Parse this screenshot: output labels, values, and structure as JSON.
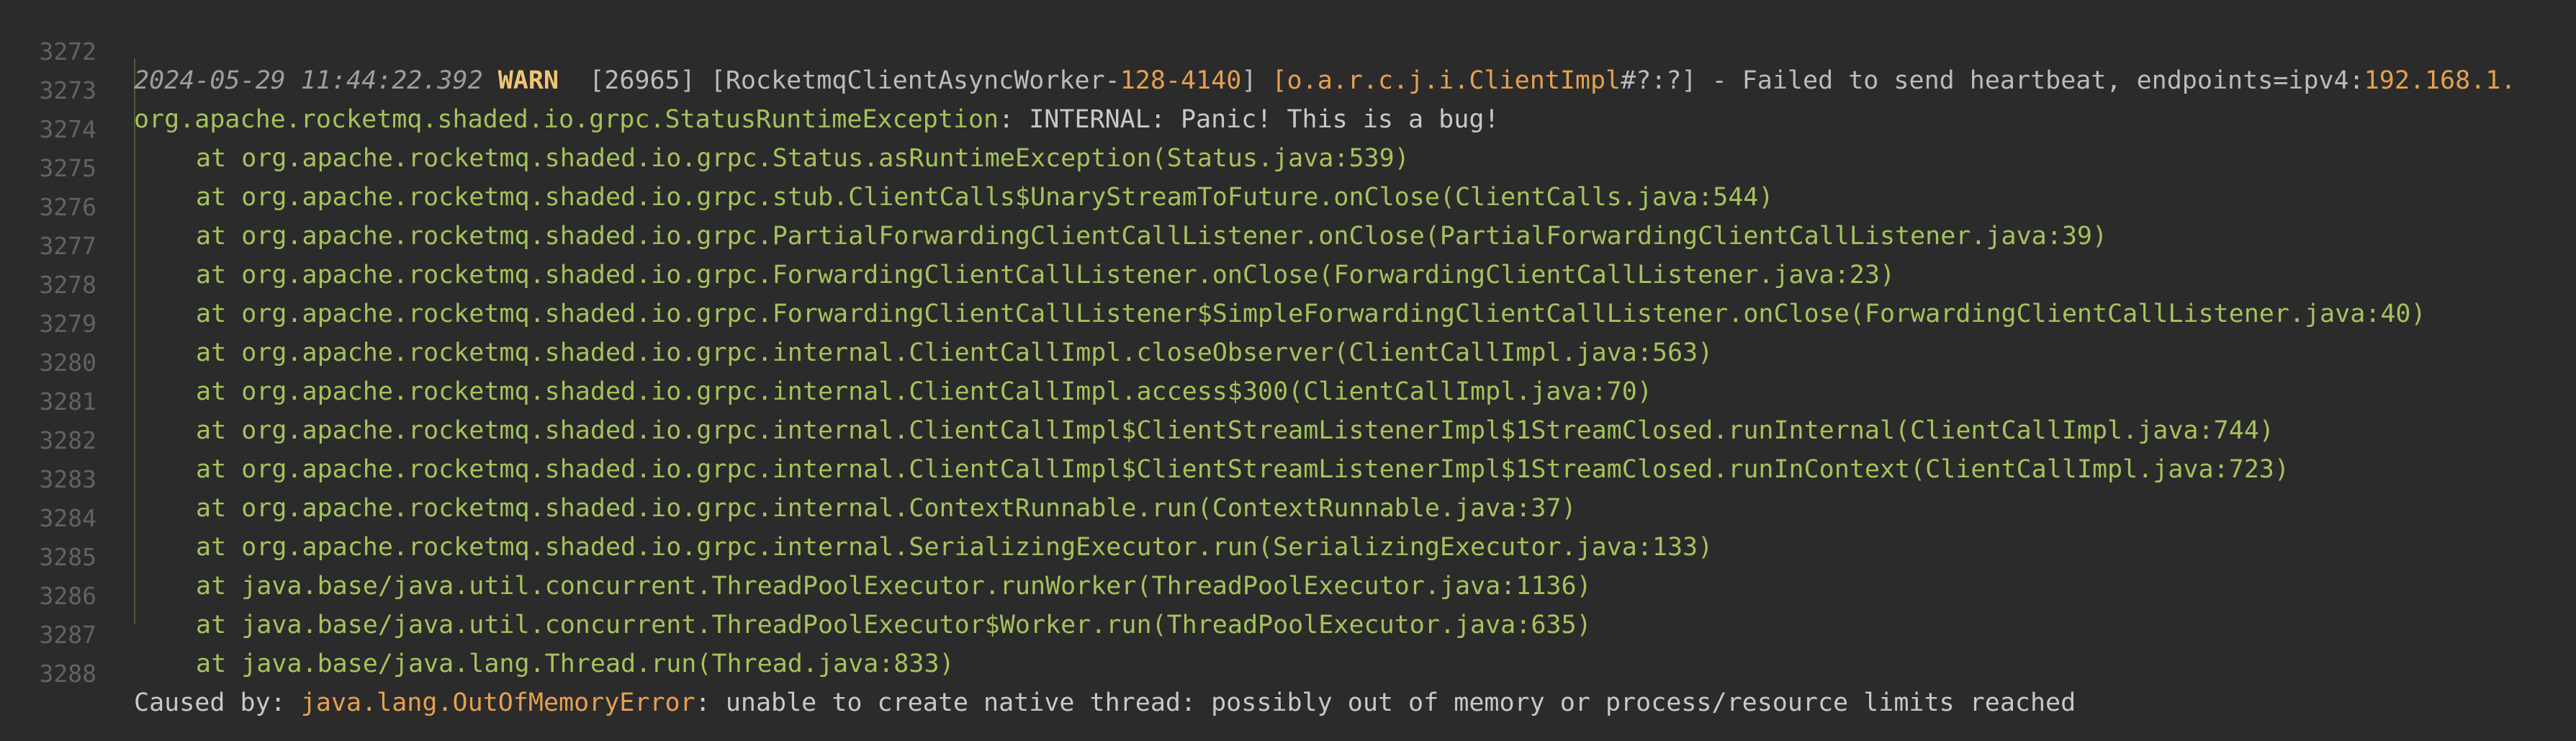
{
  "log": {
    "header": {
      "line_number": "3272",
      "timestamp": "2024-05-29 11:44:22.392",
      "level": "WARN",
      "pid": "26965",
      "thread_prefix": "[RocketmqClientAsyncWorker-",
      "thread_id": "128-4140",
      "thread_suffix": "]",
      "logger": "o.a.r.c.j.i.ClientImpl",
      "logger_suffix": "#?:?] - Failed to send heartbeat, endpoints=ipv4:",
      "endpoint_ip": "192.168.1."
    },
    "exception": {
      "line_number": "3273",
      "class": "org.apache.rocketmq.shaded.io.grpc.StatusRuntimeException",
      "message": ": INTERNAL: Panic! This is a bug!"
    },
    "stack": [
      {
        "line_number": "3274",
        "text": "at org.apache.rocketmq.shaded.io.grpc.Status.asRuntimeException(Status.java:539)"
      },
      {
        "line_number": "3275",
        "text": "at org.apache.rocketmq.shaded.io.grpc.stub.ClientCalls$UnaryStreamToFuture.onClose(ClientCalls.java:544)"
      },
      {
        "line_number": "3276",
        "text": "at org.apache.rocketmq.shaded.io.grpc.PartialForwardingClientCallListener.onClose(PartialForwardingClientCallListener.java:39)"
      },
      {
        "line_number": "3277",
        "text": "at org.apache.rocketmq.shaded.io.grpc.ForwardingClientCallListener.onClose(ForwardingClientCallListener.java:23)"
      },
      {
        "line_number": "3278",
        "text": "at org.apache.rocketmq.shaded.io.grpc.ForwardingClientCallListener$SimpleForwardingClientCallListener.onClose(ForwardingClientCallListener.java:40)"
      },
      {
        "line_number": "3279",
        "text": "at org.apache.rocketmq.shaded.io.grpc.internal.ClientCallImpl.closeObserver(ClientCallImpl.java:563)"
      },
      {
        "line_number": "3280",
        "text": "at org.apache.rocketmq.shaded.io.grpc.internal.ClientCallImpl.access$300(ClientCallImpl.java:70)"
      },
      {
        "line_number": "3281",
        "text": "at org.apache.rocketmq.shaded.io.grpc.internal.ClientCallImpl$ClientStreamListenerImpl$1StreamClosed.runInternal(ClientCallImpl.java:744)"
      },
      {
        "line_number": "3282",
        "text": "at org.apache.rocketmq.shaded.io.grpc.internal.ClientCallImpl$ClientStreamListenerImpl$1StreamClosed.runInContext(ClientCallImpl.java:723)"
      },
      {
        "line_number": "3283",
        "text": "at org.apache.rocketmq.shaded.io.grpc.internal.ContextRunnable.run(ContextRunnable.java:37)"
      },
      {
        "line_number": "3284",
        "text": "at org.apache.rocketmq.shaded.io.grpc.internal.SerializingExecutor.run(SerializingExecutor.java:133)"
      },
      {
        "line_number": "3285",
        "text": "at java.base/java.util.concurrent.ThreadPoolExecutor.runWorker(ThreadPoolExecutor.java:1136)"
      },
      {
        "line_number": "3286",
        "text": "at java.base/java.util.concurrent.ThreadPoolExecutor$Worker.run(ThreadPoolExecutor.java:635)"
      },
      {
        "line_number": "3287",
        "text": "at java.base/java.lang.Thread.run(Thread.java:833)"
      }
    ],
    "caused_by": {
      "line_number": "3288",
      "prefix": "Caused by: ",
      "class": "java.lang.OutOfMemoryError",
      "message": ": unable to create native thread: possibly out of memory or process/resource limits reached"
    }
  },
  "colors": {
    "background": "#2b2b2b",
    "line_number": "#606366",
    "warn": "#f0c674",
    "orange": "#e5a04f",
    "green": "#a5c25c"
  }
}
